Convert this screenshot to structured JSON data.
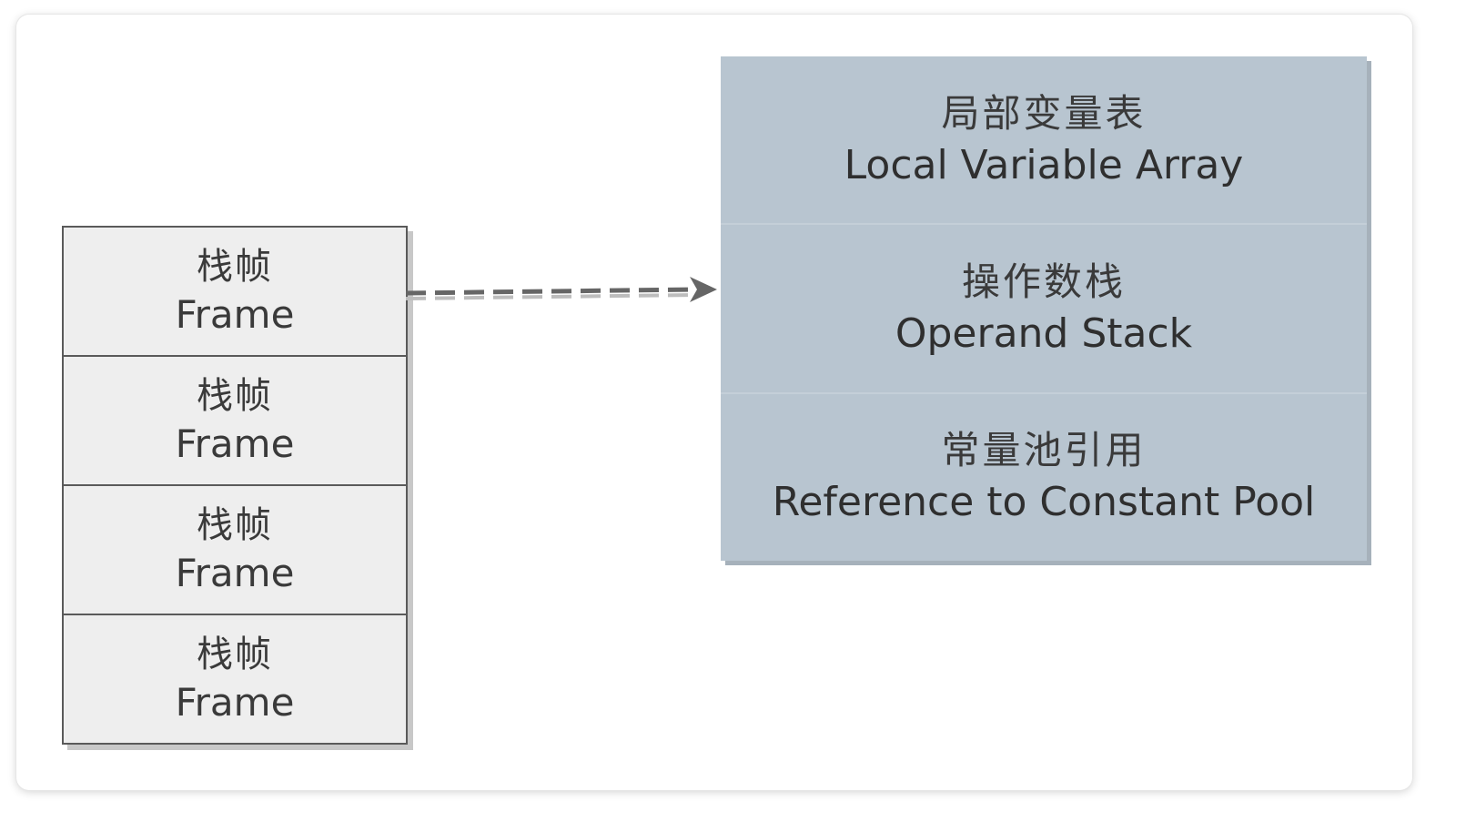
{
  "frame_stack": {
    "frames": [
      {
        "zh": "栈帧",
        "en": "Frame"
      },
      {
        "zh": "栈帧",
        "en": "Frame"
      },
      {
        "zh": "栈帧",
        "en": "Frame"
      },
      {
        "zh": "栈帧",
        "en": "Frame"
      }
    ]
  },
  "frame_detail": {
    "sections": [
      {
        "zh": "局部变量表",
        "en": "Local Variable Array"
      },
      {
        "zh": "操作数栈",
        "en": "Operand Stack"
      },
      {
        "zh": "常量池引用",
        "en": "Reference to Constant Pool"
      }
    ]
  },
  "colors": {
    "frame_fill": "#eeeeee",
    "frame_border": "#5a5a5a",
    "detail_fill": "#b8c5d0",
    "arrow": "#666666"
  }
}
